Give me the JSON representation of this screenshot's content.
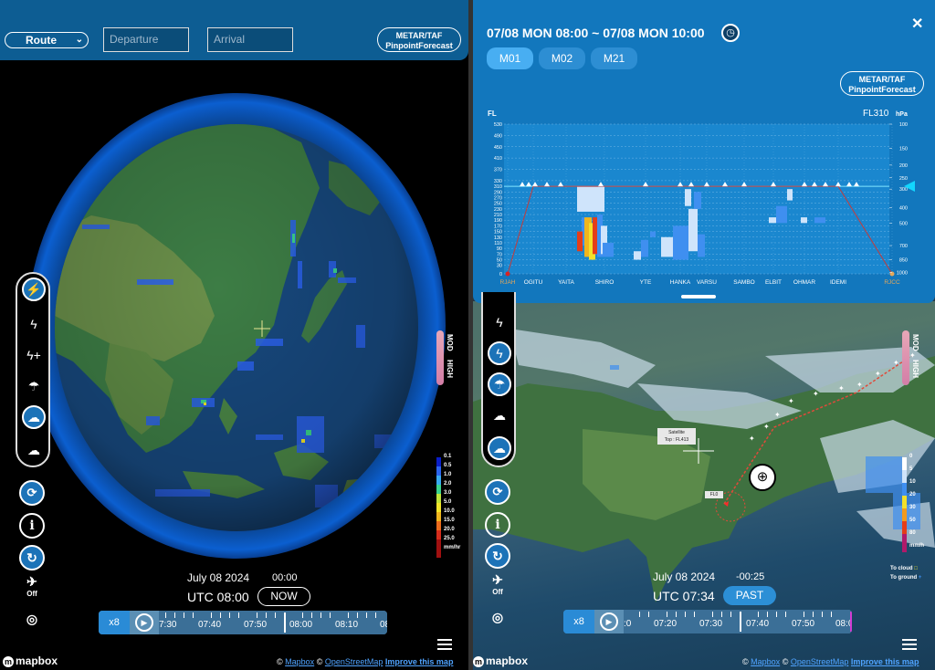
{
  "left": {
    "route_select": "Route",
    "departure_placeholder": "Departure",
    "arrival_placeholder": "Arrival",
    "metar_line1": "METAR/TAF",
    "metar_line2": "PinpointForecast",
    "legend_title": "mm/hr",
    "legend": [
      "0.1",
      "0.5",
      "1.0",
      "2.0",
      "3.0",
      "5.0",
      "10.0",
      "15.0",
      "20.0",
      "25.0"
    ],
    "legend_colors": [
      "#0a1ec8",
      "#2b63ee",
      "#37a8f0",
      "#3ad28c",
      "#bfe33a",
      "#f2e42a",
      "#f0b51e",
      "#ec6b1c",
      "#d62c1c",
      "#a01010"
    ],
    "mod": "MOD",
    "high": "HIGH",
    "date": "July 08 2024",
    "offset": "00:00",
    "utc": "UTC 08:00",
    "now_label": "NOW",
    "speed": "x8",
    "timeline_labels": [
      "7:30",
      "07:40",
      "07:50",
      "08:00",
      "08:10",
      "08"
    ],
    "mapbox": "mapbox",
    "attribution": {
      "copyright1": "©",
      "mapbox": "Mapbox",
      "copyright2": "©",
      "osm": "OpenStreetMap",
      "improve": "Improve this map"
    },
    "off_label": "Off"
  },
  "right": {
    "title": "07/08 MON 08:00 ~ 07/08 MON 10:00",
    "tabs": [
      "M01",
      "M02",
      "M21"
    ],
    "metar_line1": "METAR/TAF",
    "metar_line2": "PinpointForecast",
    "mod": "MOD",
    "high": "HIGH",
    "legend_title": "mm/h",
    "legend": [
      "0",
      "5",
      "10",
      "20",
      "30",
      "50",
      "80"
    ],
    "legend_colors": [
      "#ffffff",
      "#cfe4fb",
      "#3f8ff0",
      "#f3e02a",
      "#f29a1d",
      "#e43d19",
      "#b01a6a"
    ],
    "to_cloud": "To cloud",
    "to_ground": "To ground",
    "satellite_label1": "Satellite",
    "satellite_label2": "Top : FL413",
    "flight_label": "FL0",
    "date": "July 08 2024",
    "offset": "-00:25",
    "utc": "UTC 07:34",
    "past_label": "PAST",
    "speed": "x8",
    "timeline_labels": [
      ":0",
      "07:20",
      "07:30",
      "07:40",
      "07:50",
      "08:0"
    ],
    "mapbox": "mapbox",
    "attribution": {
      "copyright1": "©",
      "mapbox": "Mapbox",
      "copyright2": "©",
      "osm": "OpenStreetMap",
      "improve": "Improve this map"
    },
    "off_label": "Off"
  },
  "chart_data": {
    "type": "heatmap",
    "title": "FL310",
    "ylabel_left": "FL",
    "ylabel_right": "hPa",
    "y_fl_ticks": [
      0,
      30,
      50,
      70,
      90,
      110,
      130,
      150,
      170,
      190,
      210,
      230,
      250,
      270,
      290,
      310,
      330,
      370,
      410,
      450,
      490,
      530
    ],
    "y_hpa_ticks": [
      100,
      150,
      200,
      250,
      300,
      400,
      500,
      700,
      850,
      1000
    ],
    "waypoints": [
      "RJAH",
      "OGITU",
      "YAITA",
      "SHIRO",
      "YTE",
      "HANKA",
      "VARSU",
      "SAMBO",
      "ELBIT",
      "OHMAR",
      "IDEMI",
      "RJCC"
    ],
    "cruise_fl": 310
  }
}
